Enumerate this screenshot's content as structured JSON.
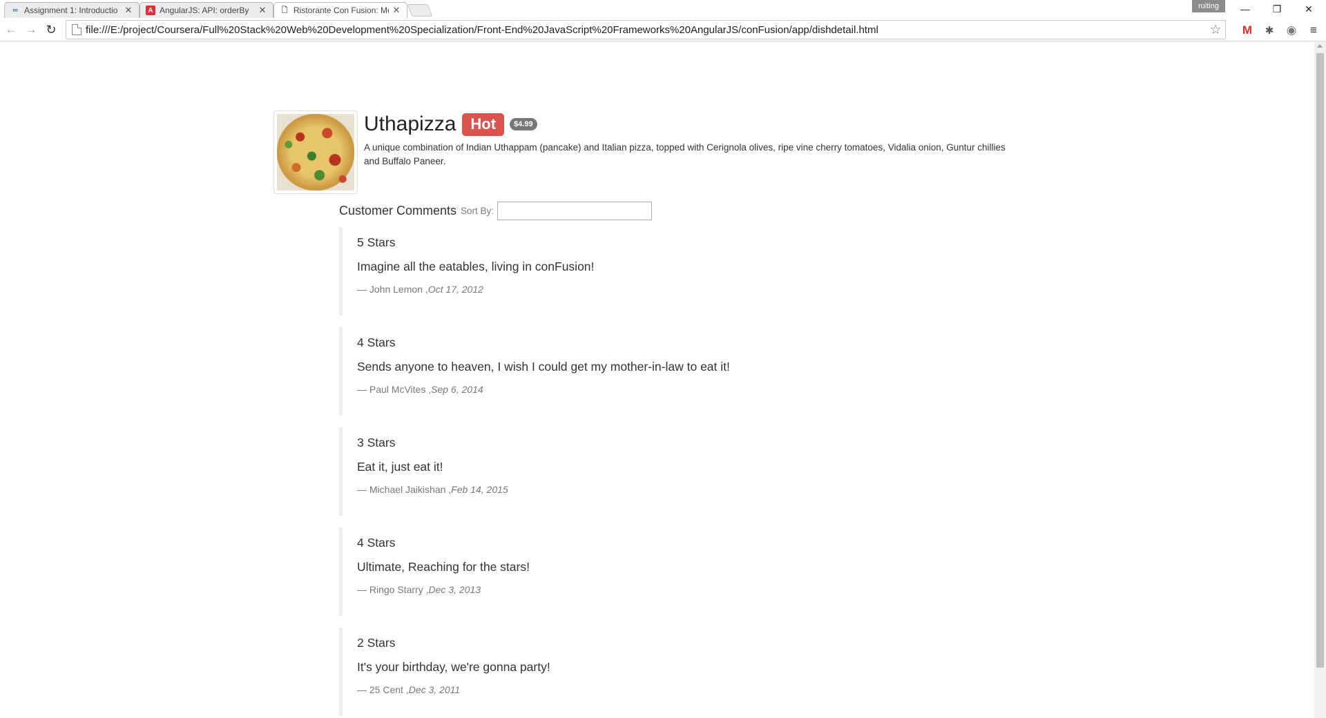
{
  "browser": {
    "tabs": [
      {
        "title": "Assignment 1: Introductio",
        "icon": "coursera-icon"
      },
      {
        "title": "AngularJS: API: orderBy",
        "icon": "angular-icon"
      },
      {
        "title": "Ristorante Con Fusion: Me",
        "icon": "page-icon",
        "active": true
      }
    ],
    "profile_name": "ruiting",
    "address": "file:///E:/project/Coursera/Full%20Stack%20Web%20Development%20Specialization/Front-End%20JavaScript%20Frameworks%20AngularJS/conFusion/app/dishdetail.html"
  },
  "dish": {
    "name": "Uthapizza",
    "label": "Hot",
    "price": "$4.99",
    "description": "A unique combination of Indian Uthappam (pancake) and Italian pizza, topped with Cerignola olives, ripe vine cherry tomatoes, Vidalia onion, Guntur chillies and Buffalo Paneer."
  },
  "comments_section": {
    "title": "Customer Comments",
    "sort_label": "Sort By:",
    "sort_value": ""
  },
  "comments": [
    {
      "stars": "5 Stars",
      "text": "Imagine all the eatables, living in conFusion!",
      "author": "— John Lemon ,",
      "date": "Oct 17, 2012"
    },
    {
      "stars": "4 Stars",
      "text": "Sends anyone to heaven, I wish I could get my mother-in-law to eat it!",
      "author": "— Paul McVites ,",
      "date": "Sep 6, 2014"
    },
    {
      "stars": "3 Stars",
      "text": "Eat it, just eat it!",
      "author": "— Michael Jaikishan ,",
      "date": "Feb 14, 2015"
    },
    {
      "stars": "4 Stars",
      "text": "Ultimate, Reaching for the stars!",
      "author": "— Ringo Starry ,",
      "date": "Dec 3, 2013"
    },
    {
      "stars": "2 Stars",
      "text": "It's your birthday, we're gonna party!",
      "author": "— 25 Cent ,",
      "date": "Dec 3, 2011"
    }
  ],
  "colors": {
    "label_hot": "#d9534f",
    "badge": "#777777",
    "comment_border": "#eeeeee"
  }
}
